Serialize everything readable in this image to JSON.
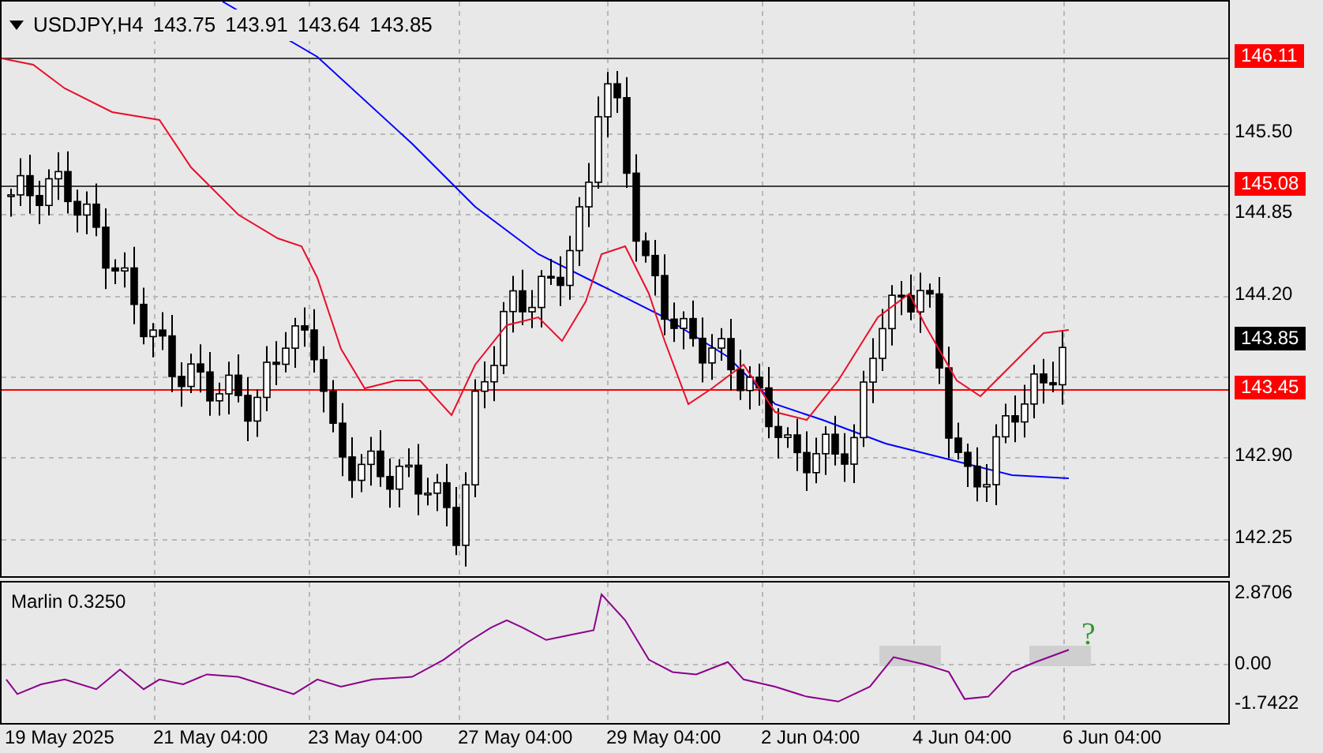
{
  "symbol_header": {
    "symbol": "USDJPY,H4",
    "open": "143.75",
    "high": "143.91",
    "low": "143.64",
    "close": "143.85"
  },
  "price_axis": [
    {
      "label": "146.11",
      "kind": "level"
    },
    {
      "label": "145.50",
      "kind": "tick"
    },
    {
      "label": "145.08",
      "kind": "level"
    },
    {
      "label": "144.85",
      "kind": "tick"
    },
    {
      "label": "144.20",
      "kind": "tick"
    },
    {
      "label": "143.85",
      "kind": "current"
    },
    {
      "label": "143.45",
      "kind": "level"
    },
    {
      "label": "142.90",
      "kind": "tick"
    },
    {
      "label": "142.25",
      "kind": "tick"
    }
  ],
  "indicator": {
    "name": "Marlin 0.3250",
    "annotation": "?"
  },
  "indicator_axis": [
    "2.8706",
    "0.00",
    "-1.7422"
  ],
  "time_axis": [
    "19 May 2025",
    "21 May 04:00",
    "23 May 04:00",
    "27 May 04:00",
    "29 May 04:00",
    "2 Jun 04:00",
    "4 Jun 04:00",
    "6 Jun 04:00"
  ]
}
